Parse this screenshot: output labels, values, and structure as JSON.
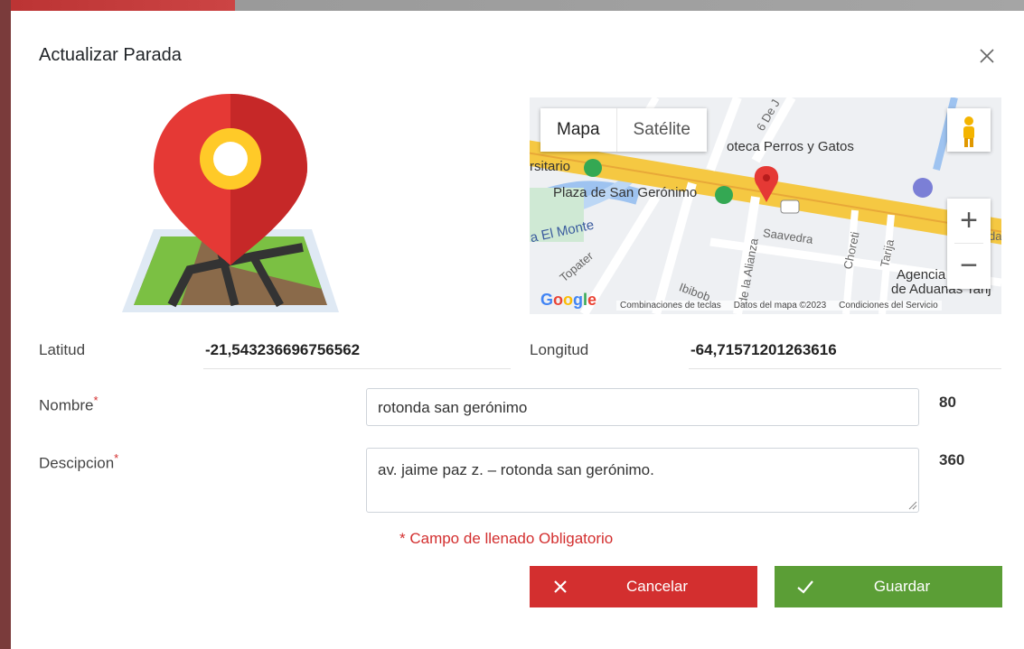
{
  "dialog": {
    "title": "Actualizar Parada",
    "close_icon": "close-icon"
  },
  "illustration": {
    "icon": "map-pin-on-map-icon"
  },
  "map": {
    "type_buttons": [
      "Mapa",
      "Satélite"
    ],
    "labels": {
      "poi_vet": "oteca Perros y Gatos",
      "poi_univ": "rsitario",
      "poi_plaza": "Plaza de San Gerónimo",
      "street_monte": "a El Monte",
      "street_saavedra": "Saavedra",
      "street_alianza": "de la Alianza",
      "street_choreti": "Choreti",
      "street_tarija": "Tarija",
      "street_topater": "Topater",
      "street_ibibob": "Ibibob",
      "street_6de": "6 De J",
      "agency": "Agencia Nac",
      "agency2": "de Aduanas Tarij",
      "edge_da": "da"
    },
    "zoom_in": "+",
    "zoom_out": "−",
    "logo": "Google",
    "attribution": [
      "Combinaciones de teclas",
      "Datos del mapa ©2023",
      "Condiciones del Servicio"
    ]
  },
  "fields": {
    "latitud_label": "Latitud",
    "latitud_value": "-21,543236696756562",
    "longitud_label": "Longitud",
    "longitud_value": "-64,71571201263616",
    "nombre_label": "Nombre",
    "nombre_value": "rotonda san gerónimo",
    "nombre_counter": "80",
    "descripcion_label": "Descipcion",
    "descripcion_value": "av. jaime paz z. – rotonda san gerónimo.",
    "descripcion_counter": "360",
    "required_mark": "*",
    "required_note": "* Campo de llenado Obligatorio"
  },
  "buttons": {
    "cancel": "Cancelar",
    "save": "Guardar"
  },
  "colors": {
    "cancel": "#d32f2f",
    "save": "#5b9e36",
    "required": "#d32f2f",
    "pin": "#e53935"
  }
}
